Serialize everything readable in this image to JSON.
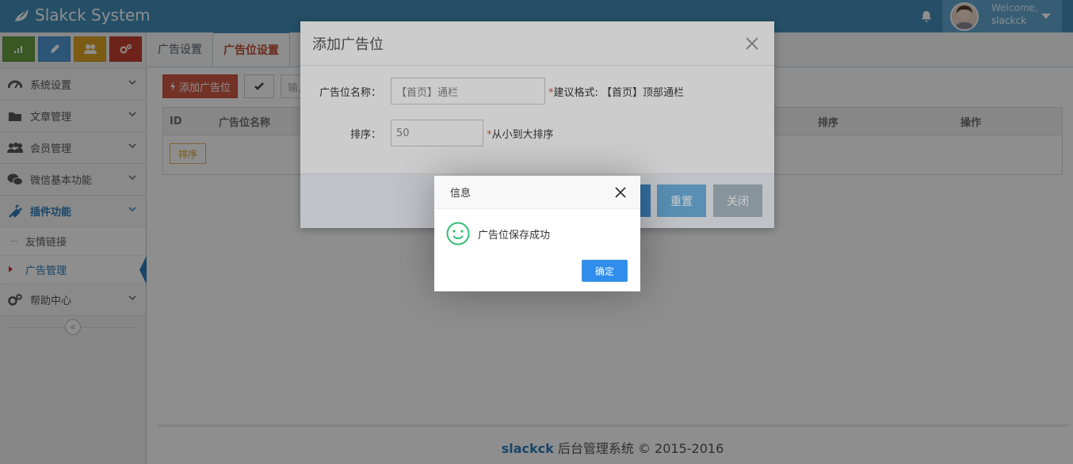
{
  "header": {
    "brand": "Slakck System",
    "welcome": "Welcome,",
    "username": "slackck"
  },
  "colors": {
    "topbar": "#438eb9",
    "shortcut_green": "#68a040",
    "shortcut_blue": "#4f9ad6",
    "shortcut_yellow": "#e0a525",
    "shortcut_red": "#c44030"
  },
  "shortcuts": [
    "stats-icon",
    "pencil-icon",
    "users-icon",
    "cogs-icon"
  ],
  "sidebar": {
    "items": [
      {
        "label": "系统设置",
        "icon": "gauge-icon"
      },
      {
        "label": "文章管理",
        "icon": "folder-icon"
      },
      {
        "label": "会员管理",
        "icon": "users-icon"
      },
      {
        "label": "微信基本功能",
        "icon": "wechat-icon"
      },
      {
        "label": "插件功能",
        "icon": "plug-icon"
      }
    ],
    "sub_items": [
      {
        "label": "友情链接"
      },
      {
        "label": "广告管理"
      }
    ],
    "help": {
      "label": "帮助中心",
      "icon": "cogs-icon"
    }
  },
  "main": {
    "tabs": [
      {
        "label": "广告设置"
      },
      {
        "label": "广告位设置"
      }
    ],
    "add_button": "添加广告位",
    "search_placeholder": "输入广",
    "table": {
      "headers": [
        "ID",
        "广告位名称",
        "排序",
        "操作"
      ],
      "sort_button": "排序"
    }
  },
  "footer": {
    "brand": "slackck",
    "text": "后台管理系统 © 2015-2016"
  },
  "modal": {
    "title": "添加广告位",
    "name_label": "广告位名称：",
    "name_value": "【首页】通栏",
    "name_hint_star": "*",
    "name_hint": "建议格式: 【首页】顶部通栏",
    "sort_label": "排序：",
    "sort_value": "50",
    "sort_hint_star": "*",
    "sort_hint": "从小到大排序",
    "reset_button": "重置",
    "close_button": "关闭"
  },
  "dialog": {
    "title": "信息",
    "message": "广告位保存成功",
    "ok_button": "确定"
  }
}
